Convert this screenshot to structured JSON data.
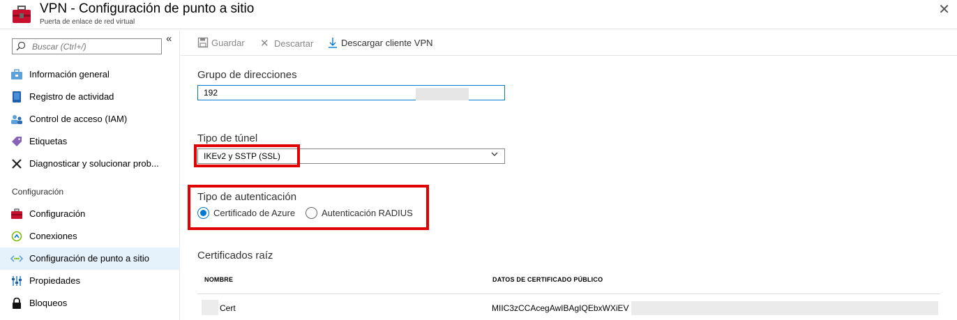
{
  "header": {
    "title": "VPN - Configuración de punto a sitio",
    "subtitle": "Puerta de enlace de red virtual",
    "icon": "toolbox-icon"
  },
  "search": {
    "placeholder": "Buscar (Ctrl+/)",
    "value": ""
  },
  "sidebar": {
    "items": [
      {
        "label": "Información general",
        "icon": "overview-icon"
      },
      {
        "label": "Registro de actividad",
        "icon": "activity-log-icon"
      },
      {
        "label": "Control de acceso (IAM)",
        "icon": "iam-icon"
      },
      {
        "label": "Etiquetas",
        "icon": "tag-icon"
      },
      {
        "label": "Diagnosticar y solucionar prob...",
        "icon": "wrench-icon"
      }
    ],
    "section_label": "Configuración",
    "section_items": [
      {
        "label": "Configuración",
        "icon": "toolbox-icon"
      },
      {
        "label": "Conexiones",
        "icon": "connections-icon"
      },
      {
        "label": "Configuración de punto a sitio",
        "icon": "point-to-site-icon",
        "selected": true
      },
      {
        "label": "Propiedades",
        "icon": "properties-icon"
      },
      {
        "label": "Bloqueos",
        "icon": "lock-icon"
      }
    ]
  },
  "toolbar": {
    "save_label": "Guardar",
    "discard_label": "Descartar",
    "download_label": "Descargar cliente VPN"
  },
  "form": {
    "address_pool_label": "Grupo de direcciones",
    "address_pool_value": "192",
    "tunnel_type_label": "Tipo de túnel",
    "tunnel_type_value": "IKEv2 y SSTP (SSL)",
    "auth_type_label": "Tipo de autenticación",
    "auth_options": [
      {
        "label": "Certificado de Azure",
        "selected": true
      },
      {
        "label": "Autenticación RADIUS",
        "selected": false
      }
    ]
  },
  "root_certs": {
    "title": "Certificados raíz",
    "columns": [
      "NOMBRE",
      "DATOS DE CERTIFICADO PÚBLICO"
    ],
    "rows": [
      {
        "name": "Cert",
        "data": "MIIC3zCCAcegAwIBAgIQEbxWXiEV"
      }
    ]
  },
  "colors": {
    "accent": "#0078d4",
    "highlight": "#e00000",
    "selected_bg": "#e5f1fb"
  }
}
